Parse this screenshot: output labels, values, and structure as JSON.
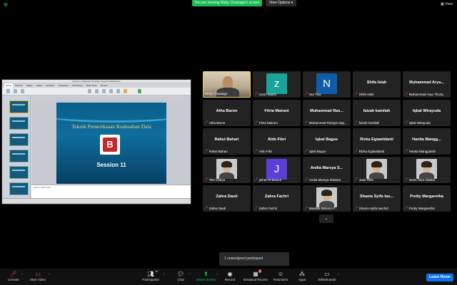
{
  "banner": {
    "sharing_text": "You are viewing Rizky Chaniago's screen",
    "view_options": "View Options ▾",
    "view_label": "View"
  },
  "shared_screen": {
    "window_title": "Session 11 Metode Penelitian Sosial Kualitatif.pptx",
    "menu_tabs": [
      "Home",
      "Themes",
      "Tables",
      "Charts",
      "SmartArt",
      "Transitions",
      "Animations",
      "Slide Show",
      "Review"
    ],
    "slide_title": "Teknik Pemeriksaan Keabsahan Data",
    "logo_letter": "B",
    "slide_session": "Session 11",
    "notes_placeholder": "Click to add notes"
  },
  "participants": [
    {
      "name": "Rizky Chaniago",
      "big": "",
      "type": "video-speaker",
      "muted": false
    },
    {
      "name": "zoom saa04",
      "big": "",
      "type": "letter",
      "letter": "z",
      "color": "#1aa39a",
      "muted": true
    },
    {
      "name": "Nur Tlus",
      "big": "",
      "type": "letter",
      "letter": "N",
      "color": "#0f5da8",
      "muted": true
    },
    {
      "name": "Shifa Islah",
      "big": "Shifa Islah",
      "type": "name",
      "muted": true
    },
    {
      "name": "Muhammad Arya Thoriq",
      "big": "Muhammad Arya...",
      "type": "name",
      "muted": true
    },
    {
      "name": "Atha Baron",
      "big": "Atha Baron",
      "type": "name",
      "muted": true
    },
    {
      "name": "Fitria Mairani",
      "big": "Fitria Mairani",
      "type": "name",
      "muted": true
    },
    {
      "name": "Muhammad Rasyya Sap...",
      "big": "Muhammad Ras...",
      "type": "name",
      "muted": true
    },
    {
      "name": "faizah kamilah",
      "big": "faizah kamilah",
      "type": "name",
      "muted": true
    },
    {
      "name": "Iqbal Wirayuda",
      "big": "Iqbal Wirayuda",
      "type": "name",
      "muted": true
    },
    {
      "name": "Rahul Bahari",
      "big": "Rahul Bahari",
      "type": "name",
      "muted": true
    },
    {
      "name": "Aldo Fikri",
      "big": "Aldo Fikri",
      "type": "name",
      "muted": true
    },
    {
      "name": "Iqbal Bagus",
      "big": "Iqbal Bagus",
      "type": "name",
      "muted": true
    },
    {
      "name": "Rizka Egiawidanti",
      "big": "Rizka Egiawidanti",
      "type": "name",
      "muted": true
    },
    {
      "name": "Hanita Manggiasih",
      "big": "Hanita Mangg...",
      "type": "name",
      "muted": true
    },
    {
      "name": "Titis Cahya",
      "big": "",
      "type": "photo",
      "muted": true
    },
    {
      "name": "jeihan el bianca",
      "big": "",
      "type": "letter",
      "letter": "J",
      "color": "#5b3fd6",
      "muted": true
    },
    {
      "name": "Andia Marsya Shabira",
      "big": "Andia Marsya S...",
      "type": "name",
      "muted": true
    },
    {
      "name": "Juan Olfin",
      "big": "",
      "type": "photo",
      "muted": true
    },
    {
      "name": "Gaim Abra Aldaha",
      "big": "",
      "type": "photo",
      "muted": true
    },
    {
      "name": "Zahra Dauti",
      "big": "Zahra Dauti",
      "type": "name",
      "muted": true
    },
    {
      "name": "Zahra Fachri",
      "big": "Zahra Fachri",
      "type": "name",
      "muted": true
    },
    {
      "name": "Maulida Beliana P...",
      "big": "",
      "type": "photo",
      "muted": true
    },
    {
      "name": "Shania Syifa tauchid",
      "big": "Shania Syifa tau...",
      "type": "name",
      "muted": true
    },
    {
      "name": "Pretty Margaretha",
      "big": "Pretty Margaretha",
      "type": "name",
      "muted": true
    }
  ],
  "unassigned_text": "1 unassigned participant",
  "toolbar": {
    "unmute": "Unmute",
    "start_video": "Start Video",
    "participants": "Participants",
    "participants_count": "26",
    "chat": "Chat",
    "share_screen": "Share Screen",
    "record": "Record",
    "breakout_rooms": "Breakout Rooms",
    "breakout_badge": "4",
    "reactions": "Reactions",
    "apps": "Apps",
    "whiteboards": "Whiteboards",
    "leave": "Leave Room"
  },
  "colors": {
    "share_banner": "#1db954",
    "leave_button": "#0e72ed",
    "mic_muted": "#e5484d",
    "speaker_border": "#e8d44d"
  }
}
